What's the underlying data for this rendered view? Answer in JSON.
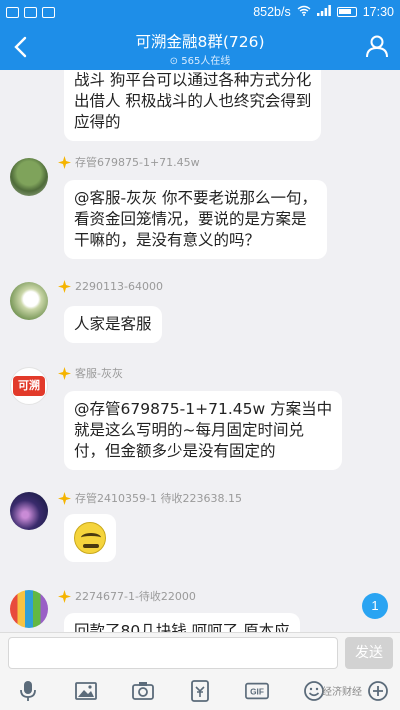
{
  "status_bar": {
    "net_speed": "852b/s",
    "time": "17:30"
  },
  "header": {
    "title": "可溯金融8群(726)",
    "online": "565人在线"
  },
  "messages": [
    {
      "lines": [
        "战斗  狗平台可以通过各种方式分化",
        "出借人  积极战斗的人也终究会得到",
        "应得的"
      ]
    },
    {
      "sender": "存管679875-1+71.45w",
      "lines": [
        "@客服-灰灰 你不要老说那么一句，",
        "看资金回笼情况，要说的是方案是",
        "干嘛的，是没有意义的吗？"
      ]
    },
    {
      "sender": "2290113-64000",
      "lines": [
        "人家是客服"
      ]
    },
    {
      "sender": "客服-灰灰",
      "avatar_text": "可溯",
      "lines": [
        "@存管679875-1+71.45w 方案当中",
        "就是这么写明的~每月固定时间兑",
        "付，但金额多少是没有固定的"
      ]
    },
    {
      "sender": "存管2410359-1 待收223638.15",
      "sticker": "grinning-emoji"
    },
    {
      "sender": "2274677-1-待收22000",
      "lines": [
        "回款了80几块钱  呵呵了  原本应"
      ]
    }
  ],
  "unread_count": "1",
  "input": {
    "placeholder": "",
    "send_label": "发送"
  },
  "toolbar": {
    "gif_label": "GIF"
  },
  "watermark": "经济财经",
  "colors": {
    "brand": "#1e8ee8",
    "bubble": "#ffffff",
    "background": "#f0f0f3"
  }
}
